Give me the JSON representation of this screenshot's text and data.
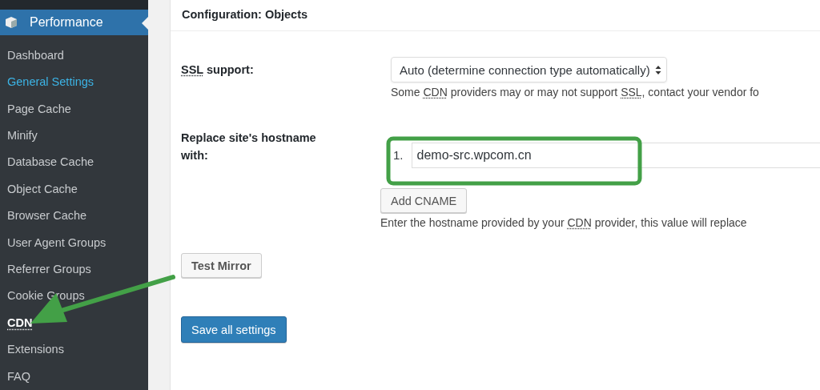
{
  "sidebar": {
    "header": "Performance",
    "items": [
      {
        "label": "Dashboard",
        "selected": false,
        "hovered": false
      },
      {
        "label": "General Settings",
        "selected": true,
        "hovered": false
      },
      {
        "label": "Page Cache",
        "selected": false,
        "hovered": false
      },
      {
        "label": "Minify",
        "selected": false,
        "hovered": false
      },
      {
        "label": "Database Cache",
        "selected": false,
        "hovered": false
      },
      {
        "label": "Object Cache",
        "selected": false,
        "hovered": false
      },
      {
        "label": "Browser Cache",
        "selected": false,
        "hovered": false
      },
      {
        "label": "User Agent Groups",
        "selected": false,
        "hovered": false
      },
      {
        "label": "Referrer Groups",
        "selected": false,
        "hovered": false
      },
      {
        "label": "Cookie Groups",
        "selected": false,
        "hovered": false
      },
      {
        "label": "CDN",
        "selected": false,
        "hovered": true
      },
      {
        "label": "Extensions",
        "selected": false,
        "hovered": false
      },
      {
        "label": "FAQ",
        "selected": false,
        "hovered": false
      }
    ]
  },
  "panel": {
    "title": "Configuration: Objects",
    "ssl": {
      "label": [
        {
          "text": "SSL",
          "abbr": true
        },
        {
          "text": " support:",
          "abbr": false
        }
      ],
      "select_value": "Auto (determine connection type automatically)",
      "hint": [
        {
          "text": "Some ",
          "abbr": false
        },
        {
          "text": "CDN",
          "abbr": true
        },
        {
          "text": " providers may or may not support ",
          "abbr": false
        },
        {
          "text": "SSL",
          "abbr": true
        },
        {
          "text": ", contact your vendor fo",
          "abbr": false
        }
      ]
    },
    "hostname": {
      "label": "Replace site's hostname with:",
      "entries": [
        {
          "number": "1.",
          "value": "demo-src.wpcom.cn"
        }
      ],
      "add_button": "Add CNAME",
      "hint": [
        {
          "text": "Enter the hostname provided by your ",
          "abbr": false
        },
        {
          "text": "CDN",
          "abbr": true
        },
        {
          "text": " provider, this value will replace",
          "abbr": false
        }
      ]
    },
    "test_button": "Test Mirror",
    "save_button": "Save all settings"
  }
}
